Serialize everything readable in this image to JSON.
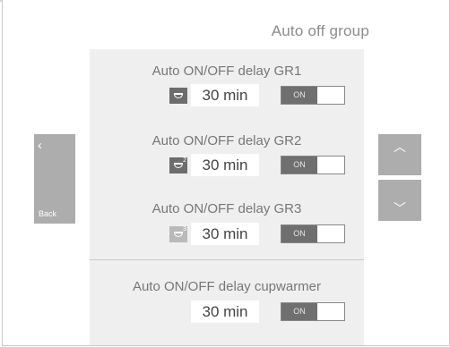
{
  "header": {
    "title": "Auto off group"
  },
  "nav": {
    "back_label": "Back",
    "back_chevron": "‹",
    "up_arrow": "︿",
    "down_arrow": "﹀"
  },
  "rows": [
    {
      "label": "Auto ON/OFF delay GR1",
      "icon": "group-1-icon",
      "value": "30 min",
      "toggle": "ON"
    },
    {
      "label": "Auto ON/OFF delay GR2",
      "icon": "group-2-icon",
      "icon_number": "2",
      "value": "30 min",
      "toggle": "ON"
    },
    {
      "label": "Auto ON/OFF delay GR3",
      "icon": "group-3-icon",
      "icon_number": "3",
      "value": "30 min",
      "toggle": "ON"
    },
    {
      "label": "Auto ON/OFF delay cupwarmer",
      "value": "30 min",
      "toggle": "ON"
    }
  ],
  "colors": {
    "button_gray": "#adadad",
    "panel_bg": "#efefef",
    "toggle_on": "#6f6f6f"
  }
}
